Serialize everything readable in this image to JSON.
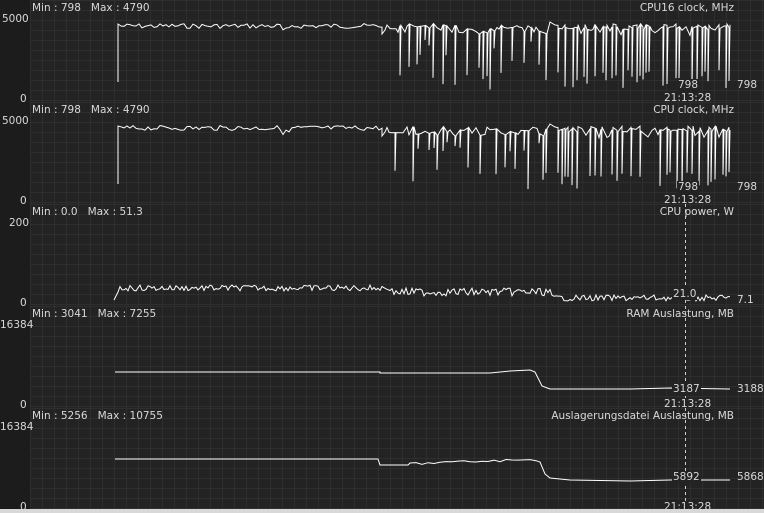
{
  "cursor_time": "21:13:28",
  "panels": [
    {
      "title": "CPU16 clock, MHz",
      "min_label": "Min : 798",
      "max_label": "Max : 4790",
      "y_max": "5000",
      "y_min": "0",
      "current_cursor": "798",
      "current_latest": "798",
      "color": "#ffffff"
    },
    {
      "title": "CPU clock, MHz",
      "min_label": "Min : 798",
      "max_label": "Max : 4790",
      "y_max": "5000",
      "y_min": "0",
      "current_cursor": "798",
      "current_latest": "798",
      "color": "#ffffff"
    },
    {
      "title": "CPU power, W",
      "min_label": "Min : 0.0",
      "max_label": "Max : 51.3",
      "y_max": "200",
      "y_min": "0",
      "current_cursor": "21.0",
      "current_latest": "7.1",
      "color": "#ffffff"
    },
    {
      "title": "RAM Auslastung, MB",
      "min_label": "Min : 3041",
      "max_label": "Max : 7255",
      "y_max": "16384",
      "y_min": "0",
      "current_cursor": "3187",
      "current_latest": "3188",
      "color": "#ffffff"
    },
    {
      "title": "Auslagerungsdatei Auslastung, MB",
      "min_label": "Min : 5256",
      "max_label": "Max : 10755",
      "y_max": "16384",
      "y_min": "0",
      "current_cursor": "5892",
      "current_latest": "5868",
      "color": "#ffffff"
    }
  ]
}
